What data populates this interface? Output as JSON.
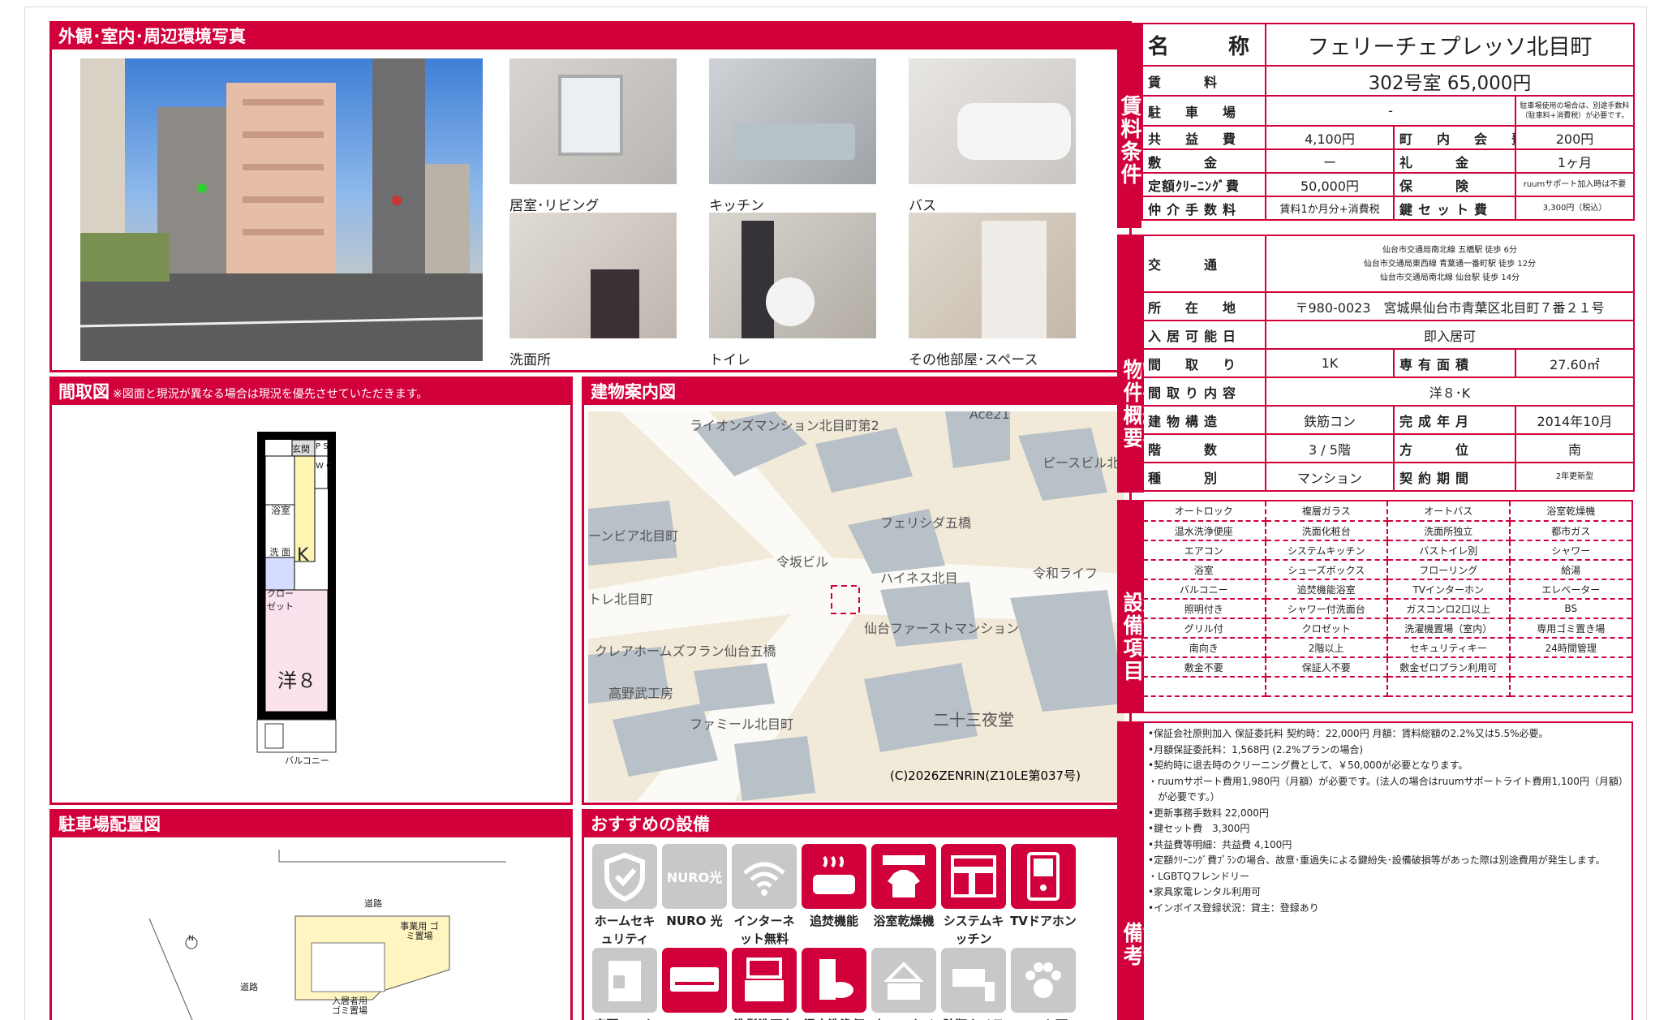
{
  "photos": {
    "title": "外観･室内･周辺環境写真",
    "captions": [
      "居室･リビング",
      "キッチン",
      "バス",
      "洗面所",
      "トイレ",
      "その他部屋･スペース"
    ]
  },
  "floorplan": {
    "title": "間取図",
    "note": "※図面と現況が異なる場合は現況を優先させていただきます。",
    "labels": {
      "entrance": "玄関",
      "ps": "P S",
      "wc": "W C",
      "bath": "浴室",
      "kitchen": "K",
      "wash": "洗 面",
      "closet": "クロー ゼット",
      "room": "洋８",
      "balcony": "バルコニー"
    }
  },
  "buildingmap": {
    "title": "建物案内図",
    "labels": [
      "ライオンズマンション北目町第2",
      "Ace21",
      "ピースビル北目町",
      "フェリシダ五橋",
      "ーンビア北目町",
      "令坂ビル",
      "ハイネス北目",
      "令和ライフ",
      "トレ北目町",
      "仙台ファーストマンション",
      "クレアホームズフラン仙台五橋",
      "高野武工房",
      "ファミール北目町",
      "二十三夜堂"
    ],
    "copyright": "(C)2026ZENRIN(Z10LE第037号)"
  },
  "parking": {
    "title": "駐車場配置図",
    "labels": {
      "road1": "道路",
      "road2": "道路",
      "garbage1": "事業用 ゴミ置場",
      "garbage2": "入居者用 ゴミ置場",
      "north": "N"
    }
  },
  "recommended": {
    "title": "おすすめの設備",
    "items": [
      {
        "label": "ホームセキュリティ",
        "icon": "shield-icon",
        "on": false
      },
      {
        "label": "NURO 光",
        "icon": "nuro-icon",
        "on": false,
        "glyph": "NURO光"
      },
      {
        "label": "インターネット無料",
        "icon": "wifi-icon",
        "on": false
      },
      {
        "label": "追焚機能",
        "icon": "bathtub-icon",
        "on": true
      },
      {
        "label": "浴室乾燥機",
        "icon": "bath-dryer-icon",
        "on": true
      },
      {
        "label": "システムキッチン",
        "icon": "kitchen-icon",
        "on": true
      },
      {
        "label": "TVドアホン",
        "icon": "intercom-icon",
        "on": true
      },
      {
        "label": "宅配ロッカー",
        "icon": "locker-icon",
        "on": false
      },
      {
        "label": "エアコン",
        "icon": "aircon-icon",
        "on": true
      },
      {
        "label": "洗髪洗面台",
        "icon": "washbasin-icon",
        "on": true
      },
      {
        "label": "温水洗浄便座",
        "icon": "toilet-icon",
        "on": true
      },
      {
        "label": "ウォークインクローゼット",
        "icon": "closet-icon",
        "on": false
      },
      {
        "label": "防犯カメラ",
        "icon": "camera-icon",
        "on": false
      },
      {
        "label": "ペット可",
        "icon": "paw-icon",
        "on": false
      }
    ],
    "accent": "#d2003a",
    "off": "#c8c8c8"
  },
  "rent": {
    "side": "賃料条件",
    "name_label": "名　　称",
    "name": "フェリーチェプレッソ北目町",
    "rent_label": "賃　　料",
    "rent": "302号室 65,000円",
    "parking_label": "駐　車　場",
    "parking": "-",
    "parking_note": "駐車場使用の場合は、別途手数料（駐車料+消費税）が必要です。",
    "common_label": "共　益　費",
    "common": "4,100円",
    "assoc_label": "町　内　会　費",
    "assoc": "200円",
    "deposit_label": "敷　　金",
    "deposit": "ー",
    "keymoney_label": "礼　　金",
    "keymoney": "1ヶ月",
    "cleaning_label": "定額ｸﾘｰﾆﾝｸﾞ費",
    "cleaning": "50,000円",
    "insurance_label": "保　　険",
    "insurance": "ruumサポート加入時は不要",
    "fee_label": "仲介手数料",
    "fee": "賃料1か月分+消費税",
    "keyset_label": "鍵セット費",
    "keyset": "3,300円（税込）"
  },
  "summary": {
    "side": "物件概要",
    "traffic_label": "交　　通",
    "traffic": [
      "仙台市交通局南北線 五橋駅 徒歩 6分",
      "仙台市交通局東西線 青葉通一番町駅 徒歩 12分",
      "仙台市交通局南北線 仙台駅 徒歩 14分"
    ],
    "address_label": "所　在　地",
    "address": "〒980-0023　宮城県仙台市青葉区北目町７番２１号",
    "movein_label": "入居可能日",
    "movein": "即入居可",
    "layout_label": "間　取　り",
    "layout": "1K",
    "area_label": "専有面積",
    "area": "27.60㎡",
    "detail_label": "間取り内容",
    "detail": "洋８･K",
    "structure_label": "建物構造",
    "structure": "鉄筋コン",
    "built_label": "完成年月",
    "built": "2014年10月",
    "floor_label": "階　　数",
    "floor": "3 / 5階",
    "direction_label": "方　　位",
    "direction": "南",
    "type_label": "種　　別",
    "type": "マンション",
    "contract_label": "契約期間",
    "contract": "2年更新型"
  },
  "equipment": {
    "side": "設備項目",
    "rows": [
      [
        "オートロック",
        "複層ガラス",
        "オートバス",
        "浴室乾燥機"
      ],
      [
        "温水洗浄便座",
        "洗面化粧台",
        "洗面所独立",
        "都市ガス"
      ],
      [
        "エアコン",
        "システムキッチン",
        "バストイレ別",
        "シャワー"
      ],
      [
        "浴室",
        "シューズボックス",
        "フローリング",
        "給湯"
      ],
      [
        "バルコニー",
        "追焚機能浴室",
        "TVインターホン",
        "エレベーター"
      ],
      [
        "照明付き",
        "シャワー付洗面台",
        "ガスコンロ2口以上",
        "BS"
      ],
      [
        "グリル付",
        "クロゼット",
        "洗濯機置場（室内）",
        "専用ゴミ置き場"
      ],
      [
        "南向き",
        "2階以上",
        "セキュリティキー",
        "24時間管理"
      ],
      [
        "敷金不要",
        "保証人不要",
        "敷金ゼロプラン利用可",
        ""
      ],
      [
        "",
        "",
        "",
        ""
      ]
    ]
  },
  "remarks": {
    "side": "備考",
    "lines": [
      "•保証会社原則加入 保証委託料 契約時：22,000円 月額：賃料総額の2.2%又は5.5%必要。",
      "•月額保証委託料：1,568円 (2.2%プランの場合)",
      "•契約時に退去時のクリーニング費として、￥50,000が必要となります。",
      "・ruumサポート費用1,980円（月額）が必要です。(法人の場合はruumサポートライト費用1,100円（月額）",
      "　が必要です。）",
      "•更新事務手数料 22,000円",
      "•鍵セット費　3,300円",
      "•共益費等明細：共益費 4,100円",
      "•定額ｸﾘｰﾆﾝｸﾞ費ﾌﾟﾗﾝの場合、故意･重過失による鍵紛失･設備破損等があった際は別途費用が発生します。",
      "・LGBTQフレンドリー",
      "•家具家電レンタル利用可",
      "•インボイス登録状況：貸主：登録あり"
    ]
  }
}
